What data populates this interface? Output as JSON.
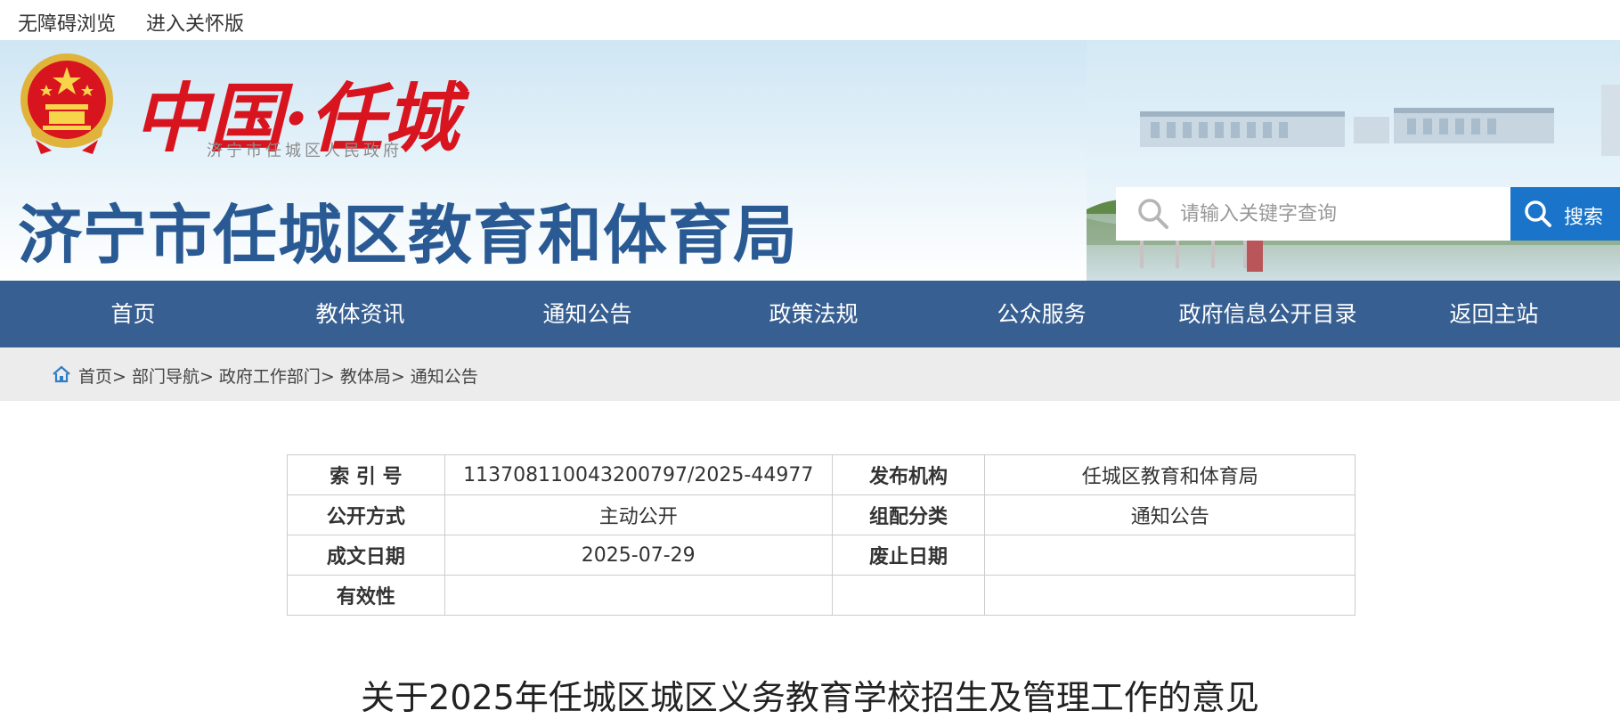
{
  "topbar": {
    "accessible_link": "无障碍浏览",
    "care_link": "进入关怀版"
  },
  "banner": {
    "logo_text": "中国·任城",
    "logo_subtitle": "济宁市任城区人民政府",
    "site_title": "济宁市任城区教育和体育局"
  },
  "search": {
    "placeholder": "请输入关键字查询",
    "button_label": "搜索"
  },
  "nav": {
    "items": [
      {
        "label": "首页"
      },
      {
        "label": "教体资讯"
      },
      {
        "label": "通知公告"
      },
      {
        "label": "政策法规"
      },
      {
        "label": "公众服务"
      },
      {
        "label": "政府信息公开目录"
      },
      {
        "label": "返回主站"
      }
    ]
  },
  "breadcrumb": {
    "items": [
      "首页",
      "部门导航",
      "政府工作部门",
      "教体局",
      "通知公告"
    ],
    "separator": ">"
  },
  "info_table": {
    "rows": [
      {
        "k1": "索 引 号",
        "v1": "113708110043200797/2025-44977",
        "k2": "发布机构",
        "v2": "任城区教育和体育局"
      },
      {
        "k1": "公开方式",
        "v1": "主动公开",
        "k2": "组配分类",
        "v2": "通知公告"
      },
      {
        "k1": "成文日期",
        "v1": "2025-07-29",
        "k2": "废止日期",
        "v2": ""
      },
      {
        "k1": "有效性",
        "v1": "",
        "k2": "",
        "v2": ""
      }
    ]
  },
  "document": {
    "title": "关于2025年任城区城区义务教育学校招生及管理工作的意见"
  },
  "colors": {
    "nav_bg": "#385f92",
    "title_blue": "#2a5a93",
    "search_btn": "#1a74c9",
    "logo_red": "#d8141e"
  },
  "icons": {
    "search": "search-icon",
    "home": "home-icon",
    "emblem": "national-emblem-icon"
  }
}
